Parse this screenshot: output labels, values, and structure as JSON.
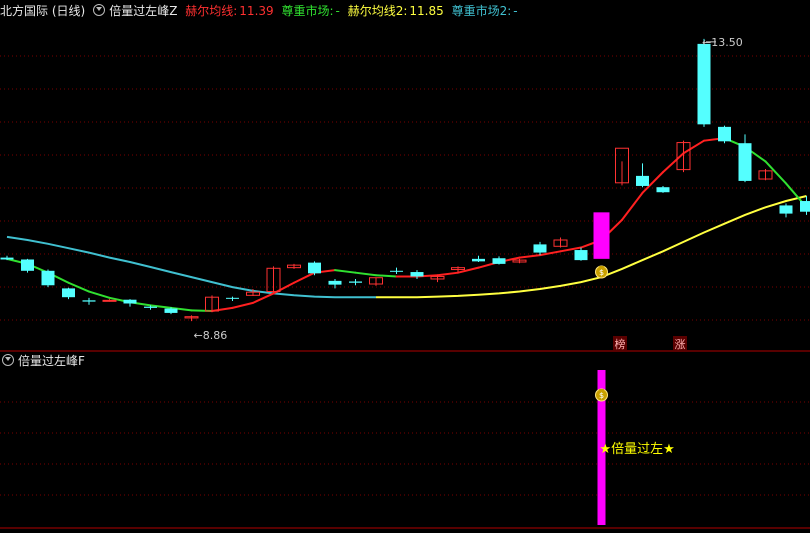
{
  "header": {
    "symbol": "北方国际 (日线)",
    "indicator": "倍量过左峰Z",
    "ma_label": "赫尔均线:",
    "ma_value": "11.39",
    "respect_label": "尊重市场:",
    "respect_value": "-",
    "ma2_label": "赫尔均线2:",
    "ma2_value": "11.85",
    "respect2_label": "尊重市场2:",
    "respect2_value": "-"
  },
  "sub_header": {
    "indicator": "倍量过左峰F"
  },
  "colors": {
    "up": "#ff3232",
    "down": "#54ffff",
    "ma_up": "#ff2020",
    "ma_down": "#30e030",
    "slow_early": "#40c0d0",
    "slow_late": "#ffff40",
    "signal": "#ff00ff",
    "grid": "#7a0000",
    "star": "#ffff00"
  },
  "chart_data": {
    "type": "candlestick",
    "annotations": {
      "high_label": "13.50",
      "low_label": "8.86",
      "signal_text": "★倍量过左★",
      "marker_a": "榜",
      "marker_b": "涨",
      "money_icon": "money-bag"
    },
    "candles": [
      {
        "o": 10.02,
        "h": 10.05,
        "l": 9.98,
        "c": 9.99
      },
      {
        "o": 9.99,
        "h": 10.0,
        "l": 9.78,
        "c": 9.81
      },
      {
        "o": 9.81,
        "h": 9.83,
        "l": 9.55,
        "c": 9.58
      },
      {
        "o": 9.53,
        "h": 9.54,
        "l": 9.36,
        "c": 9.39
      },
      {
        "o": 9.34,
        "h": 9.38,
        "l": 9.27,
        "c": 9.32
      },
      {
        "o": 9.34,
        "h": 9.36,
        "l": 9.32,
        "c": 9.34
      },
      {
        "o": 9.35,
        "h": 9.36,
        "l": 9.24,
        "c": 9.29
      },
      {
        "o": 9.24,
        "h": 9.26,
        "l": 9.19,
        "c": 9.22
      },
      {
        "o": 9.21,
        "h": 9.23,
        "l": 9.12,
        "c": 9.14
      },
      {
        "o": 9.06,
        "h": 9.1,
        "l": 9.01,
        "c": 9.08
      },
      {
        "o": 9.17,
        "h": 9.42,
        "l": 9.15,
        "c": 9.39
      },
      {
        "o": 9.38,
        "h": 9.4,
        "l": 9.33,
        "c": 9.37
      },
      {
        "o": 9.42,
        "h": 9.52,
        "l": 9.41,
        "c": 9.47
      },
      {
        "o": 9.48,
        "h": 9.88,
        "l": 9.46,
        "c": 9.85
      },
      {
        "o": 9.86,
        "h": 9.92,
        "l": 9.84,
        "c": 9.9
      },
      {
        "o": 9.94,
        "h": 9.96,
        "l": 9.74,
        "c": 9.77
      },
      {
        "o": 9.65,
        "h": 9.68,
        "l": 9.53,
        "c": 9.59
      },
      {
        "o": 9.64,
        "h": 9.68,
        "l": 9.58,
        "c": 9.62
      },
      {
        "o": 9.6,
        "h": 9.7,
        "l": 9.57,
        "c": 9.7
      },
      {
        "o": 9.81,
        "h": 9.86,
        "l": 9.76,
        "c": 9.8
      },
      {
        "o": 9.79,
        "h": 9.82,
        "l": 9.68,
        "c": 9.72
      },
      {
        "o": 9.68,
        "h": 9.74,
        "l": 9.63,
        "c": 9.72
      },
      {
        "o": 9.83,
        "h": 9.88,
        "l": 9.78,
        "c": 9.86
      },
      {
        "o": 10.0,
        "h": 10.05,
        "l": 9.95,
        "c": 9.96
      },
      {
        "o": 10.01,
        "h": 10.04,
        "l": 9.91,
        "c": 9.92
      },
      {
        "o": 9.95,
        "h": 10.0,
        "l": 9.93,
        "c": 9.98
      },
      {
        "o": 10.23,
        "h": 10.27,
        "l": 10.06,
        "c": 10.1
      },
      {
        "o": 10.2,
        "h": 10.34,
        "l": 10.18,
        "c": 10.3
      },
      {
        "o": 10.14,
        "h": 10.18,
        "l": 9.97,
        "c": 9.98
      },
      {
        "o": 10.0,
        "h": 10.74,
        "l": 9.99,
        "c": 10.74
      },
      {
        "o": 11.21,
        "h": 11.55,
        "l": 11.17,
        "c": 11.76
      },
      {
        "o": 11.32,
        "h": 11.52,
        "l": 11.14,
        "c": 11.16
      },
      {
        "o": 11.14,
        "h": 11.16,
        "l": 11.05,
        "c": 11.06
      },
      {
        "o": 11.42,
        "h": 11.88,
        "l": 11.38,
        "c": 11.85
      },
      {
        "o": 13.42,
        "h": 13.5,
        "l": 12.1,
        "c": 12.14
      },
      {
        "o": 12.1,
        "h": 12.12,
        "l": 11.84,
        "c": 11.87
      },
      {
        "o": 11.84,
        "h": 11.98,
        "l": 11.22,
        "c": 11.24
      },
      {
        "o": 11.27,
        "h": 11.43,
        "l": 11.25,
        "c": 11.4
      },
      {
        "o": 10.85,
        "h": 10.88,
        "l": 10.66,
        "c": 10.72
      },
      {
        "o": 10.92,
        "h": 11.0,
        "l": 10.7,
        "c": 10.75
      }
    ],
    "signal_index": 29,
    "hull_fast": [
      10.0,
      9.92,
      9.78,
      9.62,
      9.48,
      9.38,
      9.31,
      9.26,
      9.22,
      9.18,
      9.17,
      9.22,
      9.3,
      9.45,
      9.62,
      9.78,
      9.82,
      9.78,
      9.74,
      9.72,
      9.72,
      9.74,
      9.78,
      9.86,
      9.95,
      10.02,
      10.06,
      10.12,
      10.18,
      10.3,
      10.62,
      11.05,
      11.38,
      11.68,
      11.88,
      11.92,
      11.78,
      11.55,
      11.2,
      10.82
    ],
    "hull_slow": [
      10.35,
      10.3,
      10.24,
      10.17,
      10.1,
      10.02,
      9.95,
      9.87,
      9.79,
      9.71,
      9.63,
      9.55,
      9.49,
      9.45,
      9.42,
      9.4,
      9.39,
      9.39,
      9.39,
      9.39,
      9.39,
      9.4,
      9.41,
      9.43,
      9.45,
      9.48,
      9.52,
      9.57,
      9.63,
      9.71,
      9.84,
      9.98,
      10.12,
      10.27,
      10.42,
      10.56,
      10.7,
      10.82,
      10.92,
      11.0
    ],
    "slow_color_change_index": 18
  }
}
